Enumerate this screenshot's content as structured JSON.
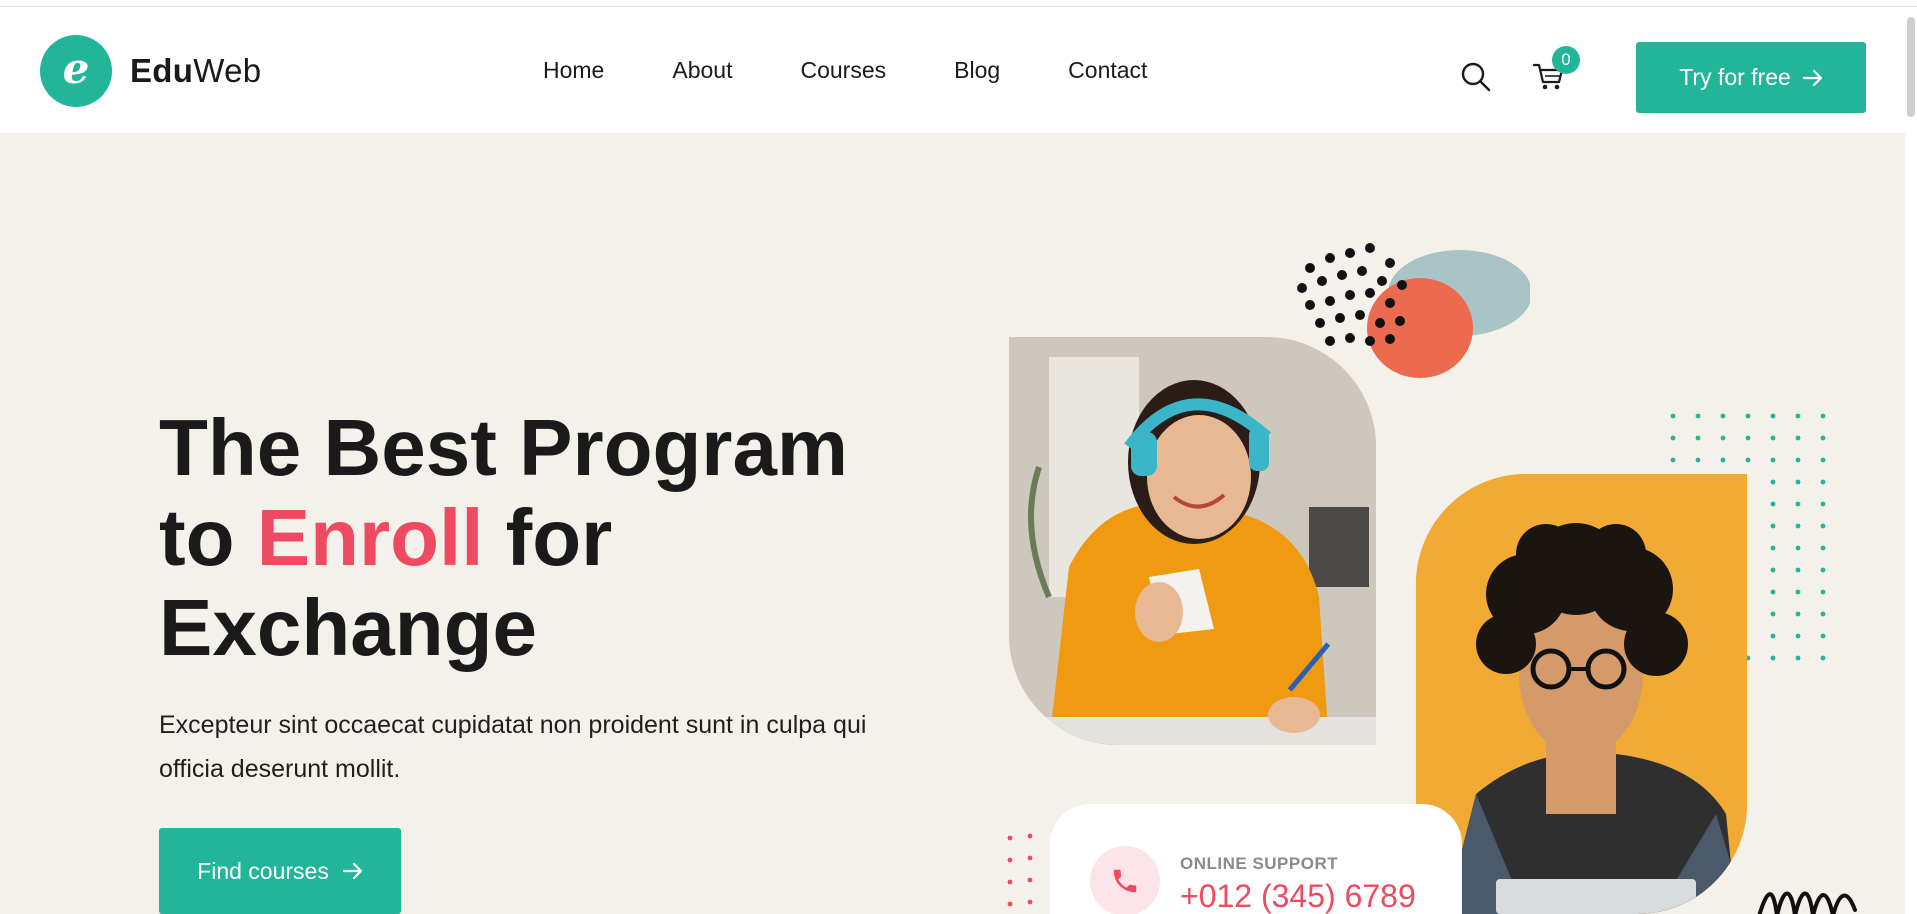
{
  "brand": {
    "name_bold": "Edu",
    "name_light": "Web",
    "logo_letter": "e"
  },
  "nav": {
    "items": [
      "Home",
      "About",
      "Courses",
      "Blog",
      "Contact"
    ]
  },
  "header": {
    "cart_count": "0",
    "cta_label": "Try for free"
  },
  "hero": {
    "headline_line1": "The Best Program",
    "headline_to": "to ",
    "headline_accent": "Enroll",
    "headline_for": " for",
    "headline_line3": "Exchange",
    "subtitle": "Excepteur sint occaecat cupidatat non proident sunt in culpa qui officia deserunt mollit.",
    "button_label": "Find courses"
  },
  "support": {
    "label": "ONLINE SUPPORT",
    "phone": "+012 (345) 6789"
  },
  "colors": {
    "accent": "#22b59a",
    "highlight": "#ee4a62",
    "hero_bg": "#f4f1eb",
    "photo2_bg": "#f1aa33"
  }
}
